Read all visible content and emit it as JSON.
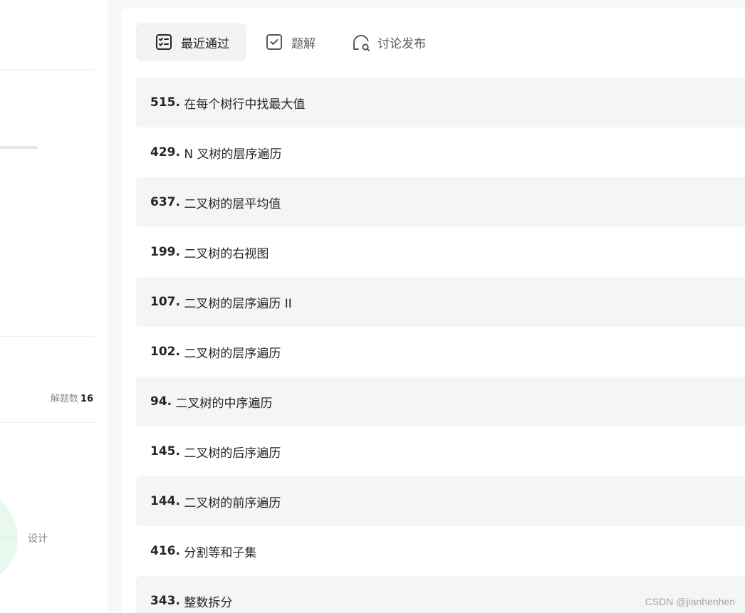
{
  "sidebar": {
    "solved_label": "解题数",
    "solved_count": "16",
    "chart_legend": "设计"
  },
  "tabs": [
    {
      "label": "最近通过",
      "icon": "checklist-icon"
    },
    {
      "label": "题解",
      "icon": "checkbox-icon"
    },
    {
      "label": "讨论发布",
      "icon": "discussion-icon"
    }
  ],
  "problems": [
    {
      "num": "515.",
      "title": "在每个树行中找最大值"
    },
    {
      "num": "429.",
      "title": "N 叉树的层序遍历"
    },
    {
      "num": "637.",
      "title": "二叉树的层平均值"
    },
    {
      "num": "199.",
      "title": "二叉树的右视图"
    },
    {
      "num": "107.",
      "title": "二叉树的层序遍历 II"
    },
    {
      "num": "102.",
      "title": "二叉树的层序遍历"
    },
    {
      "num": "94.",
      "title": "二叉树的中序遍历"
    },
    {
      "num": "145.",
      "title": "二叉树的后序遍历"
    },
    {
      "num": "144.",
      "title": "二叉树的前序遍历"
    },
    {
      "num": "416.",
      "title": "分割等和子集"
    },
    {
      "num": "343.",
      "title": "整数拆分"
    }
  ],
  "watermark": "CSDN @jianhenhen"
}
